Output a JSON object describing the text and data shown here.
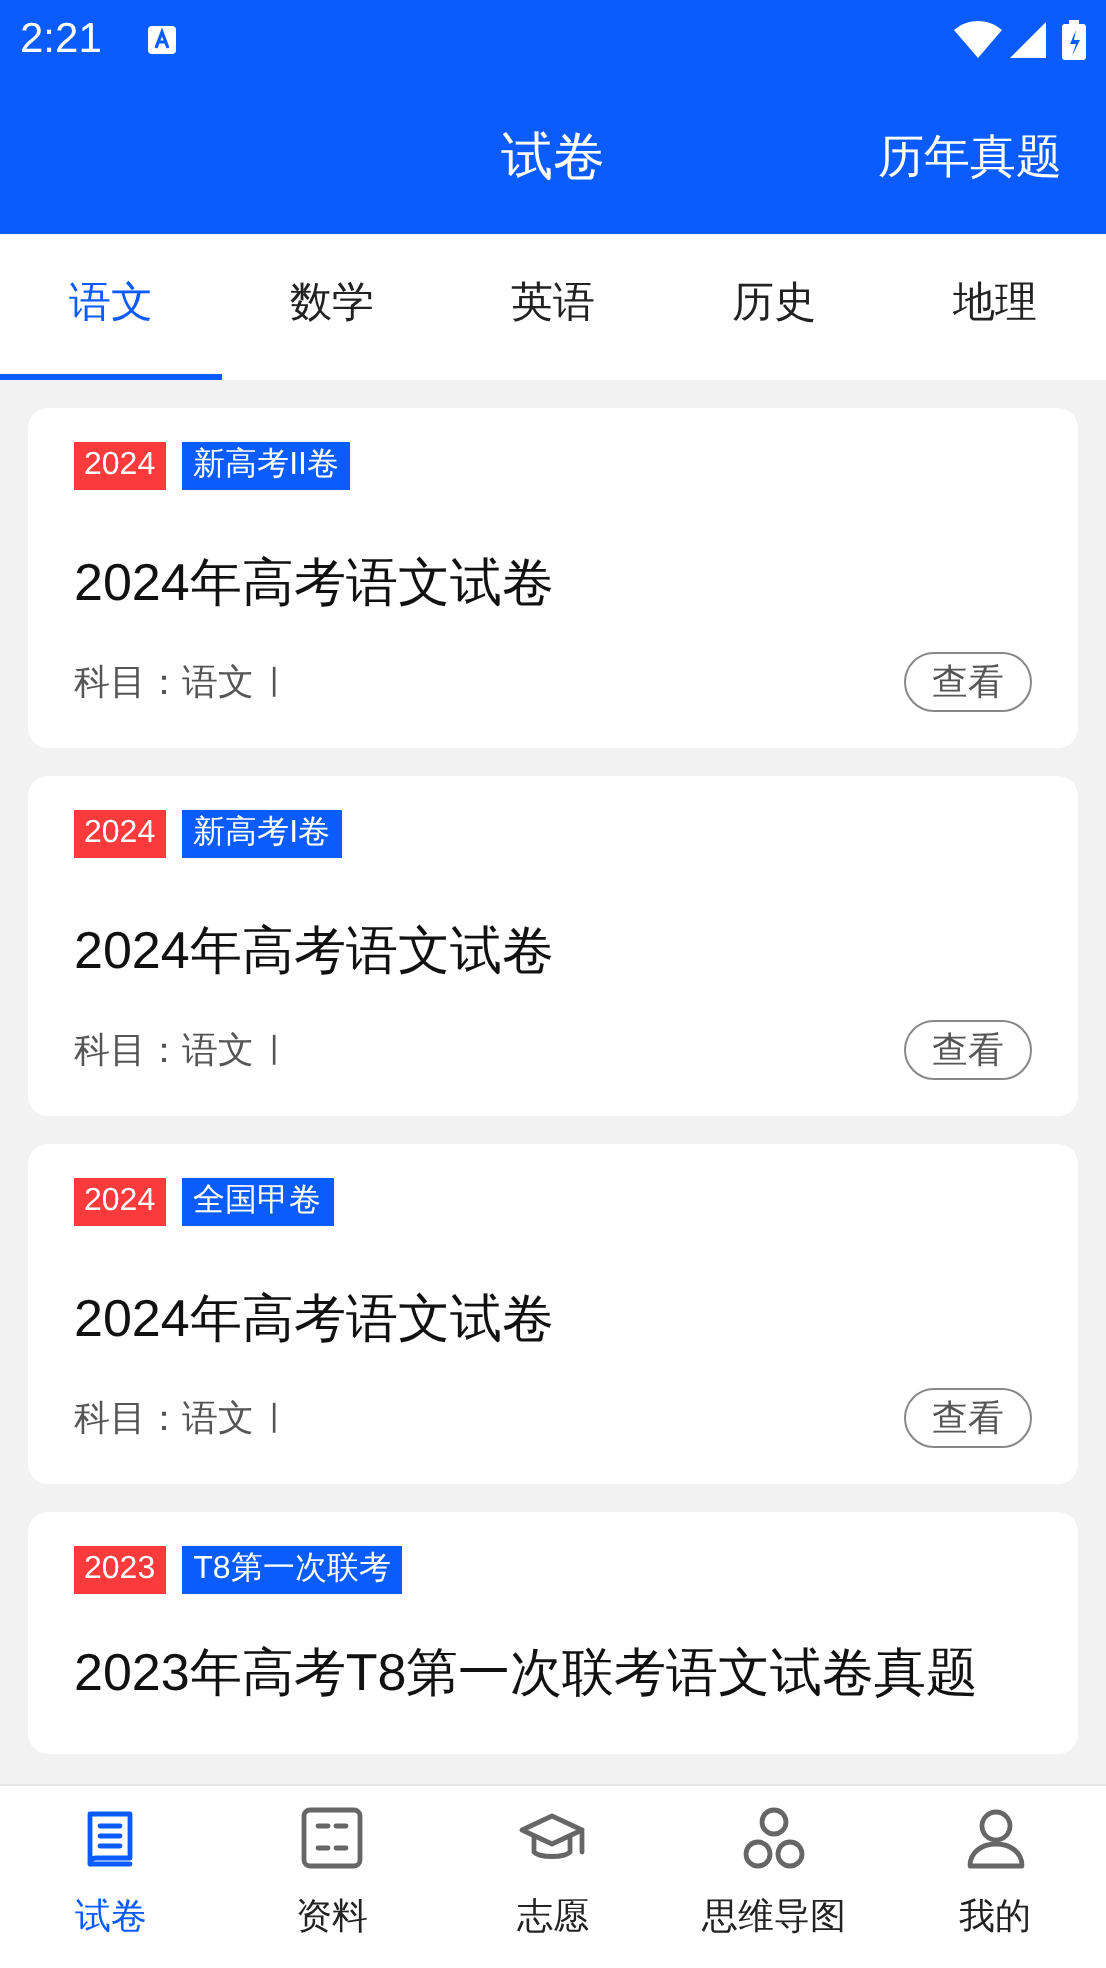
{
  "status_bar": {
    "time": "2:21"
  },
  "header": {
    "title": "试卷",
    "action": "历年真题"
  },
  "tabs": [
    {
      "label": "语文",
      "selected": true
    },
    {
      "label": "数学",
      "selected": false
    },
    {
      "label": "英语",
      "selected": false
    },
    {
      "label": "历史",
      "selected": false
    },
    {
      "label": "地理",
      "selected": false
    }
  ],
  "papers": [
    {
      "year": "2024",
      "tag": "新高考II卷",
      "title": "2024年高考语文试卷",
      "subject": "科目：语文",
      "separator": "|",
      "button": "查看"
    },
    {
      "year": "2024",
      "tag": "新高考I卷",
      "title": "2024年高考语文试卷",
      "subject": "科目：语文",
      "separator": "|",
      "button": "查看"
    },
    {
      "year": "2024",
      "tag": "全国甲卷",
      "title": "2024年高考语文试卷",
      "subject": "科目：语文",
      "separator": "|",
      "button": "查看"
    },
    {
      "year": "2023",
      "tag": "T8第一次联考",
      "title": "2023年高考T8第一次联考语文试卷真题"
    }
  ],
  "bottom_nav": [
    {
      "kind": "book",
      "label": "试卷",
      "selected": true
    },
    {
      "kind": "cards",
      "label": "资料",
      "selected": false
    },
    {
      "kind": "cap",
      "label": "志愿",
      "selected": false
    },
    {
      "kind": "mindmap",
      "label": "思维导图",
      "selected": false
    },
    {
      "kind": "person",
      "label": "我的",
      "selected": false
    }
  ]
}
